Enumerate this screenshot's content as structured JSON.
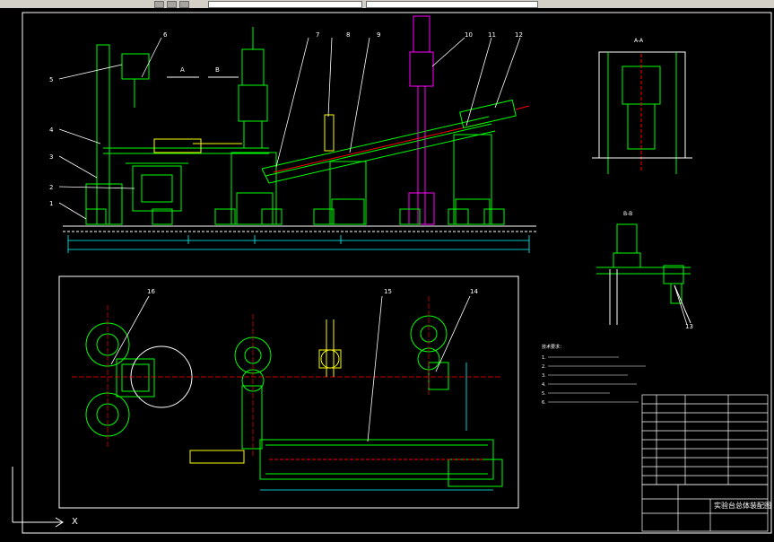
{
  "title_block": {
    "drawing_title": "实验台总体装配图"
  },
  "axis_indicator": {
    "x_label": "X"
  },
  "view_labels": {
    "section_aa": "A-A",
    "section_bb": "B-B",
    "arrow_a": "A",
    "arrow_b": "B"
  },
  "part_numbers": [
    "1",
    "2",
    "3",
    "4",
    "5",
    "6",
    "7",
    "8",
    "9",
    "10",
    "11",
    "12",
    "13",
    "14",
    "15",
    "16"
  ],
  "tech_notes": {
    "heading": "技术要求：",
    "lines": [
      "1.",
      "2.",
      "3.",
      "4.",
      "5.",
      "6."
    ]
  },
  "colors": {
    "background": "#000000",
    "frame": "#ffffff",
    "structure": "#00ff00",
    "highlight": "#ffff00",
    "cylinder": "#ff00ff",
    "text": "#ffffff",
    "dimension": "#00ffff",
    "accent_red": "#ff0000"
  }
}
